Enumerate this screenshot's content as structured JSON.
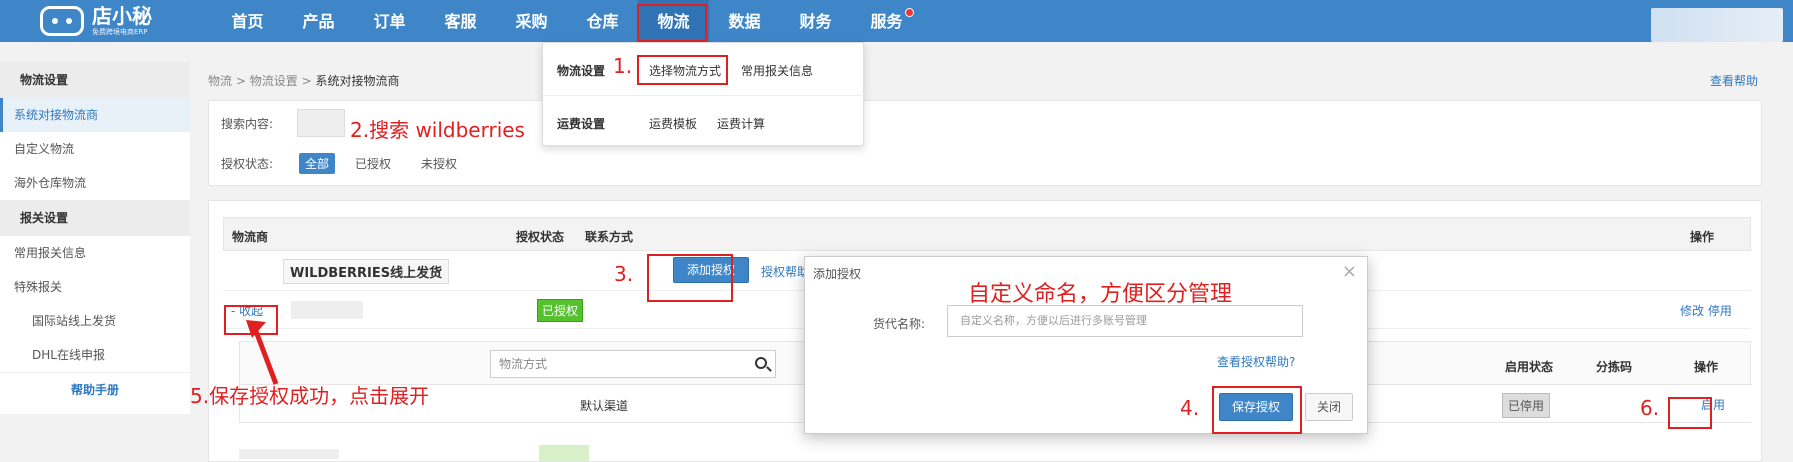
{
  "logo": {
    "title": "店小秘",
    "subtitle": "免费跨境电商ERP"
  },
  "nav": {
    "items": [
      "首页",
      "产品",
      "订单",
      "客服",
      "采购",
      "仓库",
      "物流",
      "数据",
      "财务",
      "服务"
    ],
    "active_index": 6
  },
  "dropdown": {
    "rows": [
      {
        "title": "物流设置",
        "items": [
          "选择物流方式",
          "常用报关信息"
        ]
      },
      {
        "title": "运费设置",
        "items": [
          "运费模板",
          "运费计算"
        ]
      }
    ]
  },
  "sidebar": {
    "section1": "物流设置",
    "items1": [
      "系统对接物流商",
      "自定义物流",
      "海外仓库物流"
    ],
    "section2": "报关设置",
    "items2": [
      "常用报关信息",
      "特殊报关"
    ],
    "subitems": [
      "国际站线上发货",
      "DHL在线申报"
    ],
    "help": "帮助手册"
  },
  "breadcrumb": {
    "a": "物流",
    "sep": ">",
    "b": "物流设置",
    "c": "系统对接物流商"
  },
  "help_link": "查看帮助",
  "search": {
    "label": "搜索内容:",
    "status_label": "授权状态:",
    "filters": [
      "全部",
      "已授权",
      "未授权"
    ]
  },
  "table": {
    "headers": {
      "carrier": "物流商",
      "auth_status": "授权状态",
      "contact": "联系方式",
      "ops": "操作"
    },
    "carrier_name": "WILDBERRIES线上发货",
    "add_auth": "添加授权",
    "auth_help": "授权帮助",
    "collapse": "- 收起",
    "authorized": "已授权",
    "ops_edit": "修改 停用",
    "sub": {
      "search_placeholder": "物流方式",
      "headers": {
        "enable_status": "启用状态",
        "sort_code": "分拣码",
        "ops": "操作"
      },
      "row": {
        "channel": "默认渠道",
        "status": "已停用",
        "enable": "启用"
      }
    }
  },
  "modal": {
    "title": "添加授权",
    "close": "×",
    "label": "货代名称:",
    "placeholder": "自定义名称，方便以后进行多账号管理",
    "help": "查看授权帮助?",
    "save": "保存授权",
    "cancel": "关闭"
  },
  "annotations": {
    "a1": "1.",
    "a2": "2.搜索 wildberries",
    "a3": "3.",
    "a4": "4.",
    "a5": "5.保存授权成功，点击展开",
    "a6": "6.",
    "a_modal": "自定义命名，方便区分管理"
  },
  "colors": {
    "brand": "#3e86c8",
    "annotation": "#e02020",
    "authorized": "#56c12f"
  }
}
